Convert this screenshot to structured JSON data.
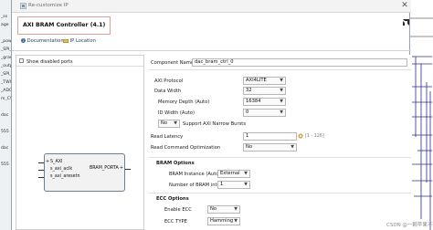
{
  "background": {
    "left_items": [
      "_ss",
      "age",
      "",
      "_powe",
      "_SPI_",
      "_grade",
      "_outpu",
      "_SPI_",
      "_TWI",
      "_ADC",
      "m_CS",
      "",
      "dac",
      "",
      "555",
      "",
      "dac",
      "",
      "555"
    ]
  },
  "dialog": {
    "title": "Re-customize IP",
    "close_icon": "close-icon",
    "ip_title": "AXI BRAM Controller (4.1)",
    "logo": "amd-xilinx-logo-icon"
  },
  "links": {
    "documentation": "Documentation",
    "ip_location": "IP Location"
  },
  "left_pane": {
    "show_disabled_ports": "Show disabled ports",
    "block": {
      "ports_left": [
        "S_AXI",
        "s_axi_aclk",
        "s_axi_aresetn"
      ],
      "port_right": "BRAM_PORTA"
    }
  },
  "form": {
    "component_name_label": "Component Name",
    "component_name_value": "dac_bram_ctrl_0",
    "axi_protocol_label": "AXI Protocol",
    "axi_protocol_value": "AXI4LITE",
    "data_width_label": "Data Width",
    "data_width_value": "32",
    "memory_depth_label": "Memory Depth (Auto)",
    "memory_depth_value": "16384",
    "id_width_label": "ID Width (Auto)",
    "id_width_value": "0",
    "narrow_bursts_label": "Support AXI Narrow Bursts",
    "narrow_bursts_value": "No",
    "read_latency_label": "Read Latency",
    "read_latency_value": "1",
    "read_latency_range": "[1 - 126]",
    "read_cmd_opt_label": "Read Command Optimization",
    "read_cmd_opt_value": "No",
    "bram_options_title": "BRAM Options",
    "bram_instance_label": "BRAM Instance (Auto)",
    "bram_instance_value": "External",
    "num_bram_if_label": "Number of BRAM interfaces",
    "num_bram_if_value": "1",
    "ecc_options_title": "ECC Options",
    "enable_ecc_label": "Enable ECC",
    "enable_ecc_value": "No",
    "ecc_type_label": "ECC TYPE",
    "ecc_type_value": "Hamming"
  },
  "watermark": "CSDN @一颗苹果不落地"
}
